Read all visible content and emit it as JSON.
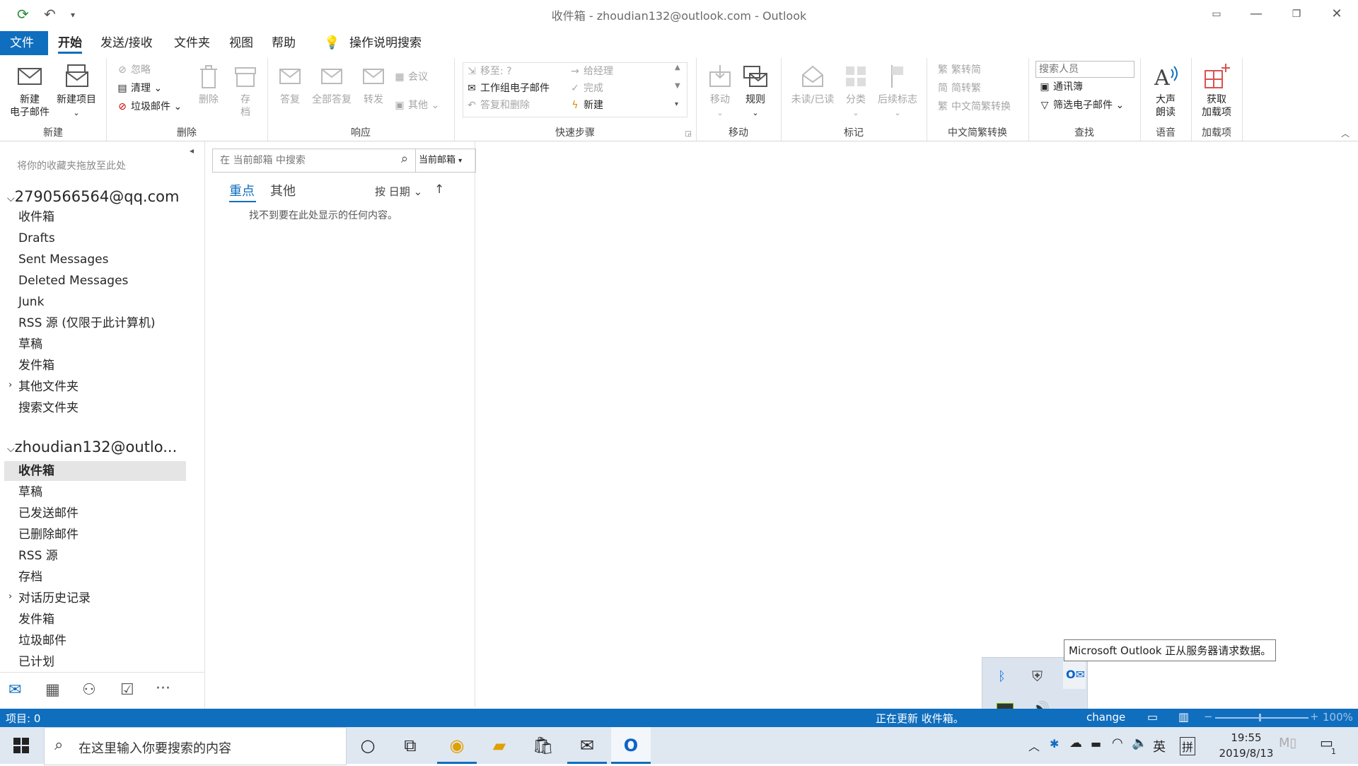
{
  "window": {
    "title": "收件箱 - zhoudian132@outlook.com  -  Outlook"
  },
  "menu": {
    "tabs": [
      "文件",
      "开始",
      "发送/接收",
      "文件夹",
      "视图",
      "帮助"
    ],
    "tell_me": "操作说明搜索"
  },
  "ribbon": {
    "new": {
      "new_email": [
        "新建",
        "电子邮件"
      ],
      "new_items": "新建项目",
      "label": "新建"
    },
    "delete": {
      "ignore": "忽略",
      "clean": "清理",
      "junk": "垃圾邮件",
      "delete": "删除",
      "archive": [
        "存",
        "档"
      ],
      "label": "删除"
    },
    "respond": {
      "reply": "答复",
      "reply_all": "全部答复",
      "forward": "转发",
      "meeting": "会议",
      "more": "其他",
      "label": "响应"
    },
    "quicksteps": {
      "move_to": "移至: ?",
      "to_manager": "给经理",
      "team_email": "工作组电子邮件",
      "done": "完成",
      "reply_delete": "答复和删除",
      "create_new": "新建",
      "label": "快速步骤"
    },
    "move": {
      "move": "移动",
      "rules": "规则",
      "label": "移动"
    },
    "tags": {
      "unread_read": "未读/已读",
      "categorize": "分类",
      "follow_up": "后续标志",
      "label": "标记"
    },
    "chinese": {
      "t2s": "繁转简",
      "s2t": "简转繁",
      "convert": "中文简繁转换",
      "label": "中文简繁转换"
    },
    "find": {
      "search_people_placeholder": "搜索人员",
      "address_book": "通讯簿",
      "filter_email": "筛选电子邮件",
      "label": "查找"
    },
    "speech": {
      "read_aloud": [
        "大声",
        "朗读"
      ],
      "label": "语音"
    },
    "addins": {
      "get_addins": [
        "获取",
        "加载项"
      ],
      "label": "加载项"
    }
  },
  "nav": {
    "favorites_hint": "将你的收藏夹拖放至此处",
    "accounts": [
      {
        "name": "2790566564@qq.com",
        "folders": [
          "收件箱",
          "Drafts",
          "Sent Messages",
          "Deleted Messages",
          "Junk",
          "RSS 源 (仅限于此计算机)",
          "草稿",
          "发件箱",
          "其他文件夹",
          "搜索文件夹"
        ]
      },
      {
        "name": "zhoudian132@outlo...",
        "folders": [
          "收件箱",
          "草稿",
          "已发送邮件",
          "已删除邮件",
          "RSS 源",
          "存档",
          "对话历史记录",
          "发件箱",
          "垃圾邮件",
          "已计划"
        ]
      }
    ]
  },
  "maillist": {
    "search_placeholder": "在 当前邮箱 中搜索",
    "scope": "当前邮箱",
    "tab_focused": "重点",
    "tab_other": "其他",
    "sort": "按 日期",
    "empty": "找不到要在此处显示的任何内容。"
  },
  "status": {
    "items": "项目: 0",
    "updating": "正在更新 收件箱。",
    "exchange_fragment": "change",
    "zoom": "100%"
  },
  "tooltip": "Microsoft Outlook 正从服务器请求数据。",
  "taskbar": {
    "search_placeholder": "在这里输入你要搜索的内容",
    "ime1": "英",
    "ime2": "拼",
    "time": "19:55",
    "date": "2019/8/13",
    "notification_count": "1"
  },
  "colors": {
    "accent": "#106ebe",
    "addin_red": "#d9534f"
  }
}
